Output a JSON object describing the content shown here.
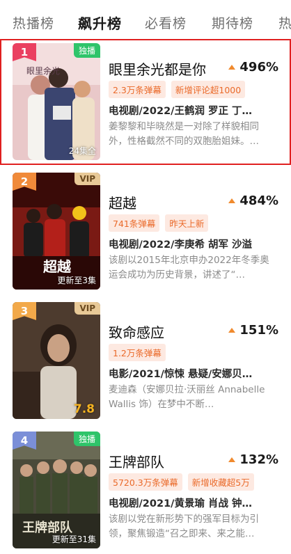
{
  "tabs": [
    {
      "label": "热播榜",
      "active": false
    },
    {
      "label": "飙升榜",
      "active": true
    },
    {
      "label": "必看榜",
      "active": false
    },
    {
      "label": "期待榜",
      "active": false
    },
    {
      "label": "热",
      "active": false
    }
  ],
  "items": [
    {
      "rank": "1",
      "badge": "独播",
      "poster_caption": "24集全",
      "title": "眼里余光都是你",
      "trend": "496%",
      "tags": [
        "2.3万条弹幕",
        "新增评论超1000"
      ],
      "meta": "电视剧/2022/王鹤润 罗正 丁…",
      "desc": "姜黎黎和毕晓然是一对除了样貌相同外，性格截然不同的双胞胎姐妹。…"
    },
    {
      "rank": "2",
      "badge": "VIP",
      "poster_caption": "更新至3集",
      "poster_text": "超越",
      "title": "超越",
      "trend": "484%",
      "tags": [
        "741条弹幕",
        "昨天上新"
      ],
      "meta": "电视剧/2022/李庚希 胡军 沙溢",
      "desc": "该剧以2015年北京申办2022年冬季奥运会成功为历史背景，讲述了“…"
    },
    {
      "rank": "3",
      "badge": "VIP",
      "poster_caption": "7.8",
      "title": "致命感应",
      "trend": "151%",
      "tags": [
        "1.2万条弹幕"
      ],
      "meta": "电影/2021/惊悚 悬疑/安娜贝…",
      "desc": "麦迪森（安娜贝拉·沃丽丝 Annabelle Wallis 饰）在梦中不断…"
    },
    {
      "rank": "4",
      "badge": "独播",
      "poster_caption": "更新至31集",
      "poster_text": "王牌部队",
      "title": "王牌部队",
      "trend": "132%",
      "tags": [
        "5720.3万条弹幕",
        "新增收藏超5万"
      ],
      "meta": "电视剧/2021/黄景瑜 肖战 钟…",
      "desc": "该剧以党在新形势下的强军目标为引领，聚焦锻造“召之即来、来之能…"
    }
  ]
}
